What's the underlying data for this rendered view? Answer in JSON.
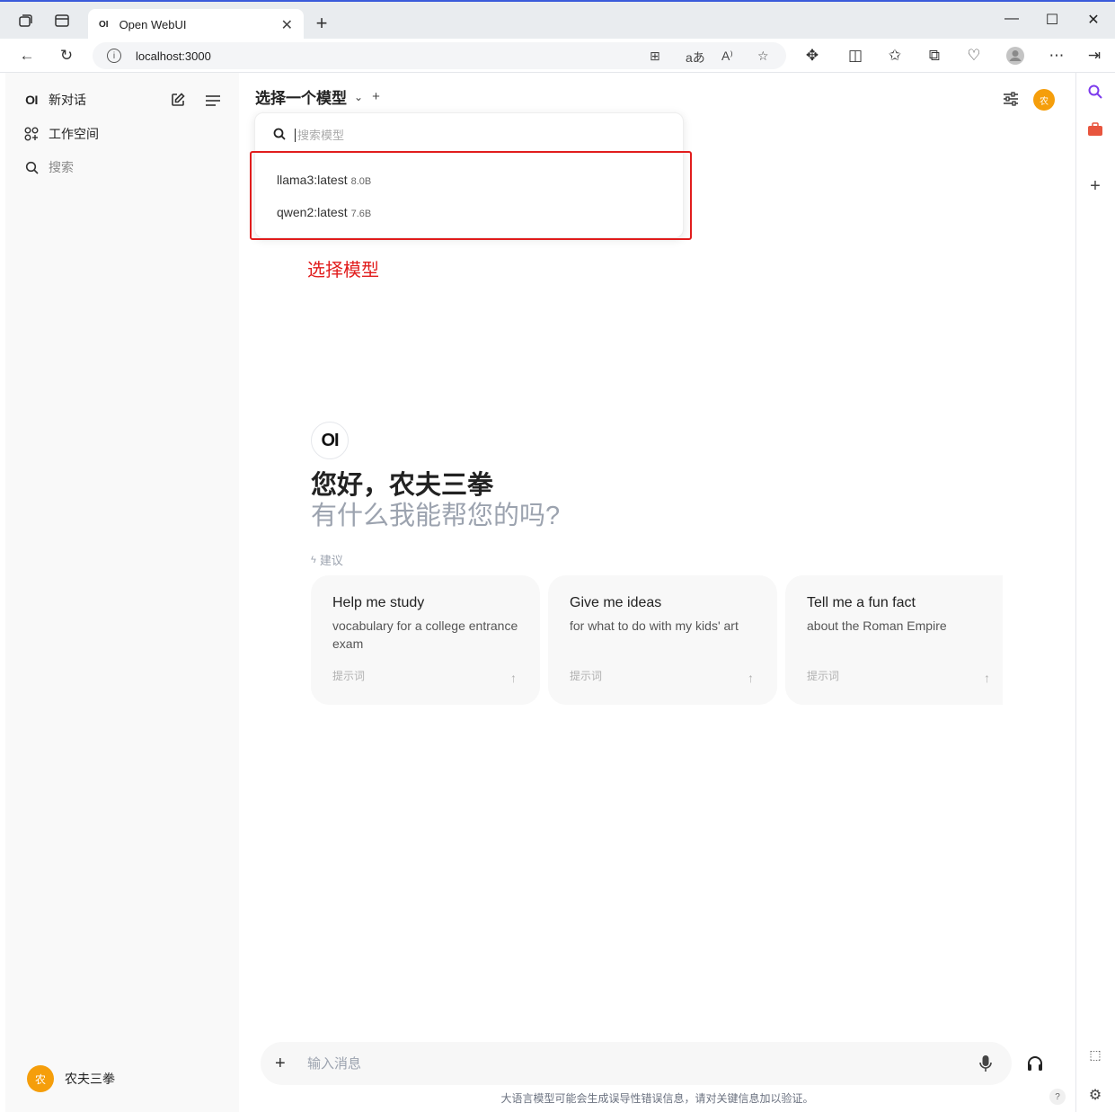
{
  "browser": {
    "tab_title": "Open WebUI",
    "tab_favicon": "OI",
    "url": "localhost:3000"
  },
  "sidebar": {
    "logo": "OI",
    "new_chat": "新对话",
    "workspace": "工作空间",
    "search": "搜索",
    "user_name": "农夫三拳",
    "user_avatar": "农"
  },
  "header": {
    "model_select": "选择一个模型",
    "avatar": "农"
  },
  "dropdown": {
    "search_placeholder": "搜索模型",
    "models": [
      {
        "name": "llama3:latest",
        "size": "8.0B"
      },
      {
        "name": "qwen2:latest",
        "size": "7.6B"
      }
    ]
  },
  "annotation": {
    "label": "选择模型",
    "color": "#e11d1d"
  },
  "welcome": {
    "logo": "OI",
    "greeting": "您好，农夫三拳",
    "subgreeting": "有什么我能帮您的吗?",
    "suggest_label": "建议"
  },
  "suggestions": [
    {
      "title": "Help me study",
      "desc": "vocabulary for a college entrance exam",
      "hint": "提示词"
    },
    {
      "title": "Give me ideas",
      "desc": "for what to do with my kids' art",
      "hint": "提示词"
    },
    {
      "title": "Tell me a fun fact",
      "desc": "about the Roman Empire",
      "hint": "提示词"
    }
  ],
  "chat": {
    "placeholder": "输入消息",
    "disclaimer": "大语言模型可能会生成误导性错误信息，请对关键信息加以验证。",
    "help": "?"
  },
  "colors": {
    "accent_avatar": "#f59e0b",
    "browser_frame": "#e9ecef"
  }
}
